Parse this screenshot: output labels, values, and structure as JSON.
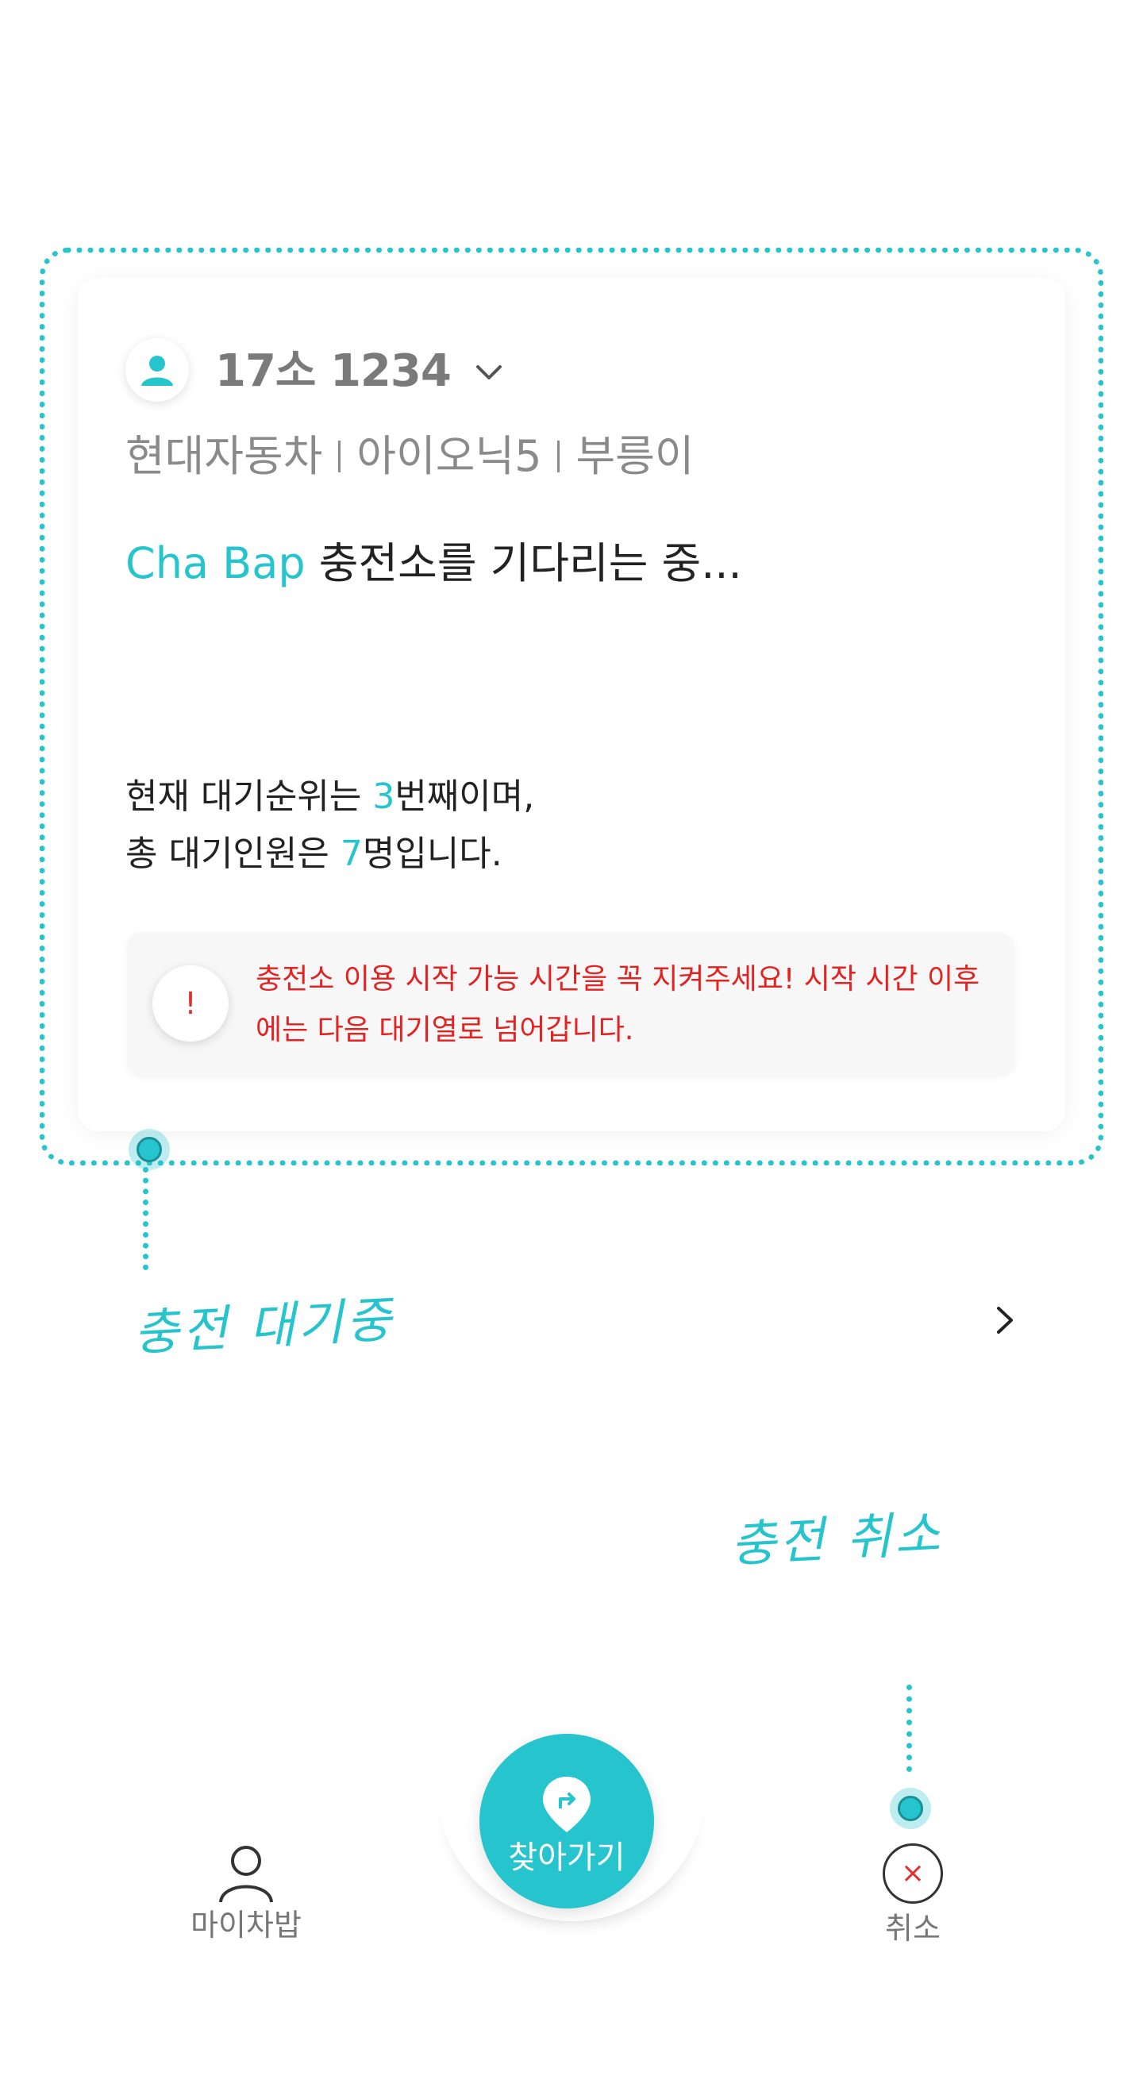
{
  "card": {
    "plate_number": "17소 1234",
    "car_info": [
      "현대자동차",
      "아이오닉5",
      "부릉이"
    ],
    "waiting_station": "Cha Bap",
    "waiting_text": " 충전소를 기다리는 중...",
    "queue_line1_prefix": "현재 대기순위는 ",
    "queue_rank": "3",
    "queue_line1_suffix": "번째이며,",
    "queue_line2_prefix": "총 대기인원은 ",
    "queue_total": "7",
    "queue_line2_suffix": "명입니다.",
    "notice_icon": "!",
    "notice_text": "충전소 이용 시작 가능 시간을 꼭 지켜주세요! 시작 시간 이후에는 다음 대기열로 넘어갑니다."
  },
  "annotations": {
    "waiting_label": "충전 대기중",
    "cancel_label": "충전 취소"
  },
  "nav": {
    "my_label": "마이차밥",
    "find_label": "찾아가기",
    "cancel_label": "취소",
    "cancel_icon": "×"
  },
  "colors": {
    "accent": "#26c4cc",
    "warning": "#e32222",
    "muted": "#8a8a8a"
  },
  "icons": [
    "user-icon",
    "chevron-down-icon",
    "chevron-right-icon",
    "directions-pin-icon",
    "person-outline-icon",
    "close-icon"
  ]
}
